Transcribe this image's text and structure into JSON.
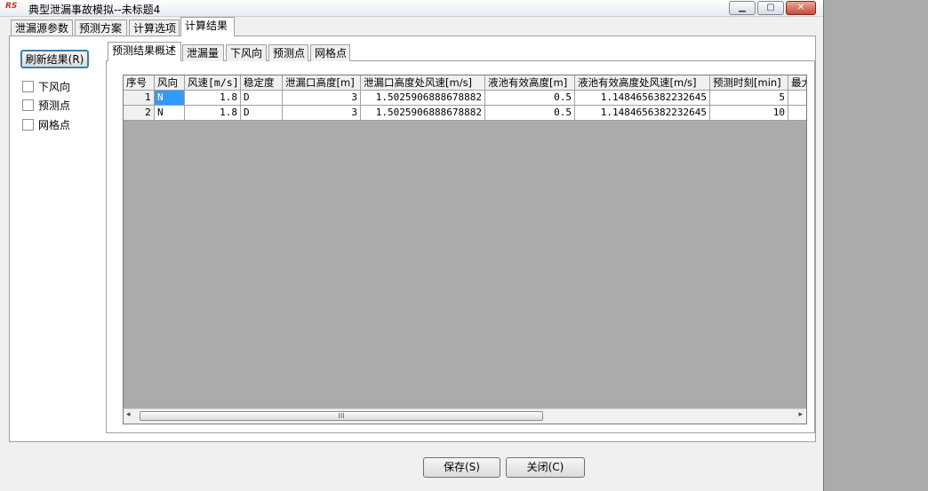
{
  "window": {
    "logo": "RS",
    "title": "典型泄漏事故模拟--未标题4",
    "min_glyph": "▁",
    "max_glyph": "▢",
    "close_glyph": "✕"
  },
  "main_tabs": [
    "泄漏源参数",
    "预测方案",
    "计算选项",
    "计算结果"
  ],
  "sidebar": {
    "refresh_button": "刷新结果(R)",
    "checkboxes": [
      "下风向",
      "预测点",
      "网格点"
    ]
  },
  "sub_tabs": [
    "预测结果概述",
    "泄漏量",
    "下风向",
    "预测点",
    "网格点"
  ],
  "table": {
    "columns": [
      "序号",
      "风向",
      "风速[m/s]",
      "稳定度",
      "泄漏口高度[m]",
      "泄漏口高度处风速[m/s]",
      "液池有效高度[m]",
      "液池有效高度处风速[m/s]",
      "预测时刻[min]",
      "最大"
    ],
    "rows": [
      [
        "1",
        "N",
        "1.8",
        "D",
        "3",
        "1.5025906888678882",
        "0.5",
        "1.1484656382232645",
        "5",
        ""
      ],
      [
        "2",
        "N",
        "1.8",
        "D",
        "3",
        "1.5025906888678882",
        "0.5",
        "1.1484656382232645",
        "10",
        ""
      ]
    ]
  },
  "scrollbar": {
    "left_arrow": "◂",
    "right_arrow": "▸",
    "grip": "III"
  },
  "footer": {
    "save_button": "保存(S)",
    "close_button": "关闭(C)"
  }
}
